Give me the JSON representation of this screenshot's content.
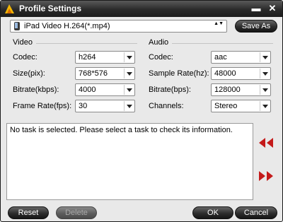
{
  "window": {
    "title": "Profile Settings",
    "minimize_glyph": "▬",
    "close_glyph": "✕"
  },
  "profile": {
    "selected": "iPad Video H.264(*.mp4)",
    "save_as_label": "Save As",
    "stepper_glyph": "▲▼"
  },
  "video": {
    "title": "Video",
    "fields": [
      {
        "label": "Codec:",
        "value": "h264"
      },
      {
        "label": "Size(pix):",
        "value": "768*576"
      },
      {
        "label": "Bitrate(kbps):",
        "value": "4000"
      },
      {
        "label": "Frame Rate(fps):",
        "value": "30"
      }
    ]
  },
  "audio": {
    "title": "Audio",
    "fields": [
      {
        "label": "Codec:",
        "value": "aac"
      },
      {
        "label": "Sample Rate(hz):",
        "value": "48000"
      },
      {
        "label": "Bitrate(bps):",
        "value": "128000"
      },
      {
        "label": "Channels:",
        "value": "Stereo"
      }
    ]
  },
  "info_message": "No task is selected. Please select a task to check its information.",
  "buttons": {
    "reset": "Reset",
    "delete": "Delete",
    "ok": "OK",
    "cancel": "Cancel"
  },
  "colors": {
    "nav_arrow": "#c41a1a",
    "titlebar": "#2a2a2a",
    "dialog_bg": "#e9e9e9"
  }
}
